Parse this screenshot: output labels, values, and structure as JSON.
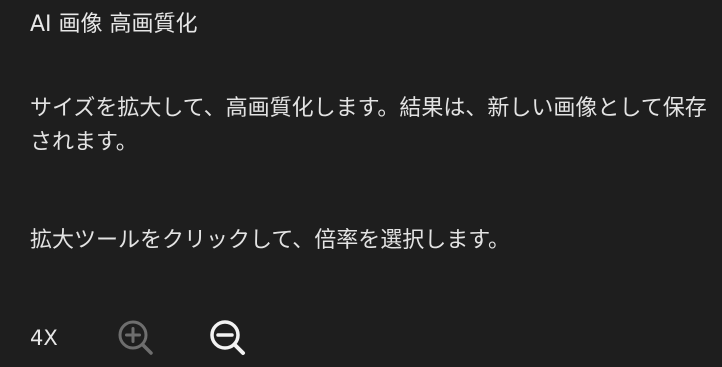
{
  "panel": {
    "title": "AI 画像 高画質化",
    "description": "サイズを拡大して、高画質化します。結果は、新しい画像として保存されます。",
    "instruction": "拡大ツールをクリックして、倍率を選択します。"
  },
  "zoom": {
    "level": "4X",
    "zoom_in_icon": "zoom-in-icon",
    "zoom_in_state": "disabled",
    "zoom_out_icon": "zoom-out-icon",
    "zoom_out_state": "enabled"
  },
  "colors": {
    "background": "#1e1e1e",
    "text": "#e6e6e6",
    "icon_disabled": "#6e6e6e",
    "icon_enabled": "#f2f2f2"
  }
}
